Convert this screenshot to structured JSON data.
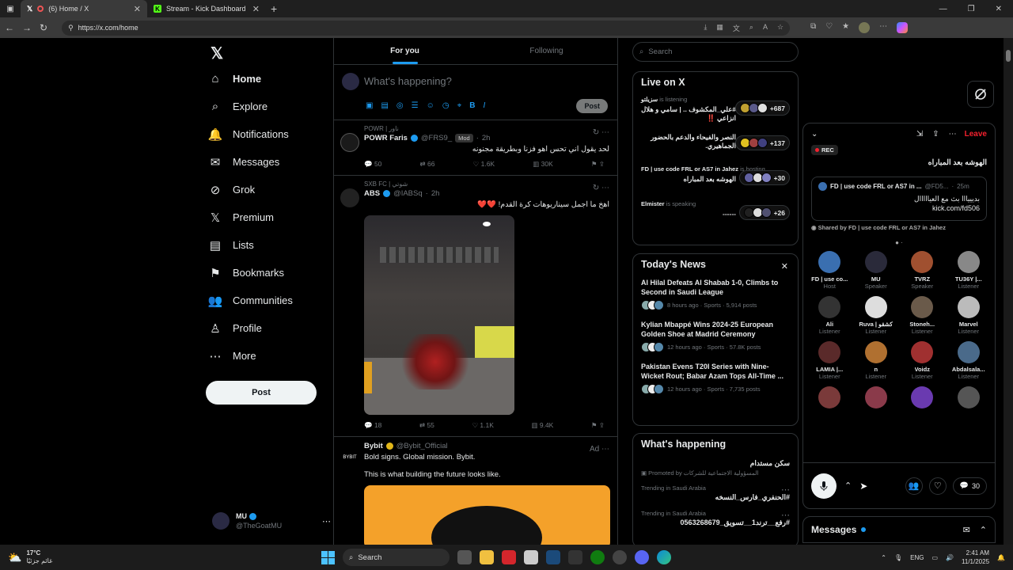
{
  "browser": {
    "tabs": [
      {
        "label": "(6) Home / X",
        "active": true
      },
      {
        "label": "Stream - Kick Dashboard",
        "active": false
      }
    ],
    "url": "https://x.com/home"
  },
  "nav": {
    "items": [
      {
        "label": "Home",
        "icon": "home-icon"
      },
      {
        "label": "Explore",
        "icon": "search-icon"
      },
      {
        "label": "Notifications",
        "icon": "bell-icon",
        "badge": ""
      },
      {
        "label": "Messages",
        "icon": "mail-icon"
      },
      {
        "label": "Grok",
        "icon": "grok-icon"
      },
      {
        "label": "Premium",
        "icon": "x-logo-icon"
      },
      {
        "label": "Lists",
        "icon": "list-icon"
      },
      {
        "label": "Bookmarks",
        "icon": "bookmark-icon"
      },
      {
        "label": "Communities",
        "icon": "people-icon"
      },
      {
        "label": "Profile",
        "icon": "person-icon"
      },
      {
        "label": "More",
        "icon": "more-circle-icon"
      }
    ],
    "post_label": "Post",
    "account": {
      "name": "MU",
      "handle": "@TheGoatMU"
    }
  },
  "feed": {
    "tabs": [
      "For you",
      "Following"
    ],
    "compose_placeholder": "What's happening?",
    "compose_post": "Post",
    "tweets": [
      {
        "context": "POWR | ناور",
        "name": "POWR Faris",
        "handle": "@FRS9_",
        "badge": "Mod",
        "time": "2h",
        "body": "لحد يقول اني تحس اهو فزنا وبطريقة مجنونه",
        "replies": "50",
        "reposts": "66",
        "likes": "1.6K",
        "views": "30K"
      },
      {
        "context": "SXB FC | شوتي",
        "name": "ABS",
        "handle": "@IABSq",
        "time": "2h",
        "body": "اهخ ما اجمل سيناريوهات كرة القدم! ❤️❤️",
        "replies": "18",
        "reposts": "55",
        "likes": "1.1K",
        "views": "9.4K"
      },
      {
        "name": "Bybit",
        "handle": "@Bybit_Official",
        "ad": "Ad",
        "body1": "Bold signs. Global mission. Bybit.",
        "body2": "This is what building the future looks like."
      }
    ]
  },
  "right": {
    "search_placeholder": "Search",
    "live": {
      "title": "Live on X",
      "items": [
        {
          "host": "سزيلتو",
          "status": "is listening",
          "title": "#علي_المكشوف .. | سامي و هلال انزاعي ‼️",
          "count": "+687"
        },
        {
          "host": "",
          "status": "",
          "title": "النصر والفيحاء والدعم بالحضور الجماهيري.",
          "count": "+137"
        },
        {
          "host": "FD | use code FRL or AS7 in Jahez",
          "status": "is hosting",
          "title": "الهوشه بعد المباراه",
          "count": "+30"
        },
        {
          "host": "Elmister",
          "status": "is speaking",
          "title": "------",
          "count": "+26"
        }
      ]
    },
    "news": {
      "title": "Today's News",
      "items": [
        {
          "title": "Al Hilal Defeats Al Shabab 1-0, Climbs to Second in Saudi League",
          "meta": "8 hours ago · Sports · 5,914 posts"
        },
        {
          "title": "Kylian Mbappé Wins 2024-25 European Golden Shoe at Madrid Ceremony",
          "meta": "12 hours ago · Sports · 57.8K posts"
        },
        {
          "title": "Pakistan Evens T20I Series with Nine-Wicket Rout; Babar Azam Tops All-Time ...",
          "meta": "12 hours ago · Sports · 7,735 posts"
        }
      ]
    },
    "happening": {
      "title": "What's happening",
      "items": [
        {
          "title": "سكن مستدام",
          "meta": "Promoted by المسؤولية الاجتماعية للشركات"
        },
        {
          "meta": "Trending in Saudi Arabia",
          "title": "#الحنفري_فارس_النسخه"
        },
        {
          "meta": "Trending in Saudi Arabia",
          "title": "#رفع__ترند1__تسويق_0563268679"
        }
      ]
    }
  },
  "space": {
    "leave": "Leave",
    "rec": "REC",
    "title": "الهوشه بعد المباراه",
    "card_head": "FD | use code FRL or AS7 in ...",
    "card_handle": "@FD5...",
    "card_time": "25m",
    "card_body1": "بديييااا بث مع العيااااال",
    "card_body2": "kick.com/fd506",
    "shared": "Shared by FD | use code FRL or AS7 in Jahez",
    "people": [
      {
        "name": "FD | use co...",
        "role": "Host",
        "color": "#3a6fb0"
      },
      {
        "name": "MU",
        "role": "Speaker",
        "color": "#2a2a3a"
      },
      {
        "name": "TVRZ",
        "role": "Speaker",
        "color": "#a05030"
      },
      {
        "name": "TU36Y |...",
        "role": "Listener",
        "color": "#888"
      },
      {
        "name": "Ali",
        "role": "Listener",
        "color": "#333"
      },
      {
        "name": "Ruva | كشقو",
        "role": "Listener",
        "color": "#ddd"
      },
      {
        "name": "Stoneh...",
        "role": "Listener",
        "color": "#6a5a4a"
      },
      {
        "name": "Marvel",
        "role": "Listener",
        "color": "#bbb"
      },
      {
        "name": "LAMIA |...",
        "role": "Listener",
        "color": "#5a2a2a"
      },
      {
        "name": "n",
        "role": "Listener",
        "color": "#b07030"
      },
      {
        "name": "Voidz",
        "role": "Listener",
        "color": "#a03030"
      },
      {
        "name": "Abdalsala...",
        "role": "Listener",
        "color": "#4a6a8a"
      },
      {
        "name": "",
        "role": "",
        "color": "#7a3a3a"
      },
      {
        "name": "",
        "role": "",
        "color": "#8a3a4a"
      },
      {
        "name": "",
        "role": "",
        "color": "#6a3ab0"
      },
      {
        "name": "",
        "role": "",
        "color": "#555"
      }
    ],
    "listeners_count": "30"
  },
  "messages_label": "Messages",
  "taskbar": {
    "temp": "17°C",
    "weather_desc": "غائم جزئيًا",
    "search": "Search",
    "lang": "ENG",
    "time": "2:41 AM",
    "date": "11/1/2025"
  }
}
